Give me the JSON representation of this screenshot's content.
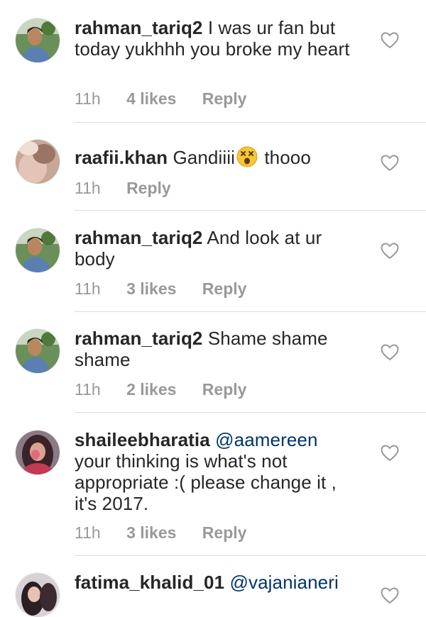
{
  "comments": [
    {
      "username": "rahman_tariq2",
      "text": "I was ur fan but today yukhhh you broke my heart",
      "time": "11h",
      "likes": "4 likes",
      "reply": "Reply"
    },
    {
      "username": "raafii.khan",
      "text_before": "Gandiiii",
      "emoji": "astonished-face-emoji",
      "text_after": " thooo",
      "time": "11h",
      "reply": "Reply"
    },
    {
      "username": "rahman_tariq2",
      "text": "And look at ur body",
      "time": "11h",
      "likes": "3 likes",
      "reply": "Reply"
    },
    {
      "username": "rahman_tariq2",
      "text": "Shame shame shame",
      "time": "11h",
      "likes": "2 likes",
      "reply": "Reply"
    },
    {
      "username": "shaileebharatia",
      "mention": "@aamereen",
      "text": "your thinking is what's not appropriate :( please change it , it's 2017.",
      "time": "11h",
      "likes": "3 likes",
      "reply": "Reply"
    },
    {
      "username": "fatima_khalid_01",
      "mention": "@vajanianeri"
    }
  ],
  "colors": {
    "text": "#262626",
    "meta": "#999999",
    "mention": "#003569",
    "divider": "#dbdbdb",
    "heart_stroke": "#999999"
  },
  "icons": {
    "like": "heart-outline-icon"
  }
}
